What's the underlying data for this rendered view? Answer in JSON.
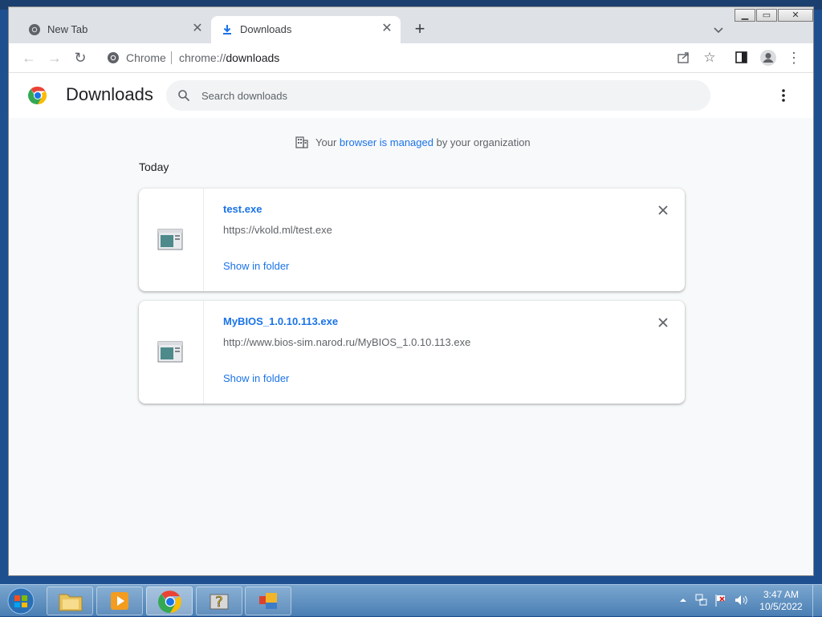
{
  "tabs": [
    {
      "title": "New Tab",
      "active": false
    },
    {
      "title": "Downloads",
      "active": true
    }
  ],
  "omnibox": {
    "site": "Chrome",
    "url_scheme": "chrome://",
    "url_path": "downloads"
  },
  "page": {
    "title": "Downloads",
    "search_placeholder": "Search downloads",
    "managed_prefix": "Your ",
    "managed_link": "browser is managed",
    "managed_suffix": " by your organization",
    "section_label": "Today"
  },
  "downloads": [
    {
      "name": "test.exe",
      "url": "https://vkold.ml/test.exe",
      "action": "Show in folder"
    },
    {
      "name": "MyBIOS_1.0.10.113.exe",
      "url": "http://www.bios-sim.narod.ru/MyBIOS_1.0.10.113.exe",
      "action": "Show in folder"
    }
  ],
  "taskbar": {
    "apps": [
      "explorer",
      "media-player",
      "chrome",
      "help",
      "control-panel"
    ],
    "time": "3:47 AM",
    "date": "10/5/2022"
  },
  "colors": {
    "accent": "#1a73e8",
    "tabstrip": "#dee1e6",
    "page_bg": "#f8f9fa"
  }
}
